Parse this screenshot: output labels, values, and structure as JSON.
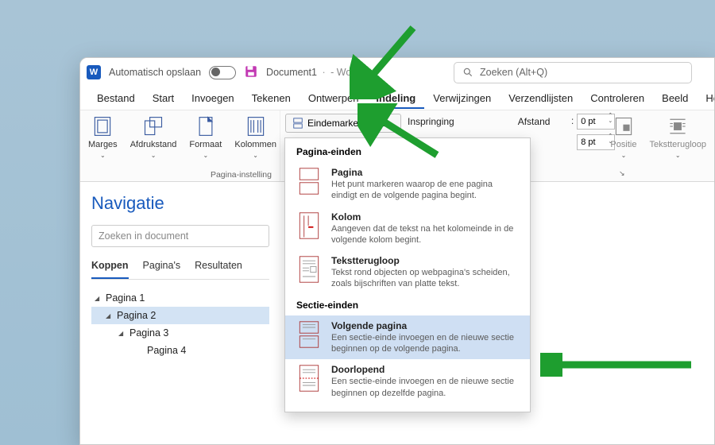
{
  "titlebar": {
    "autosave_label": "Automatisch opslaan",
    "doc_title": "Document1",
    "doc_suffix": "- Word",
    "search_placeholder": "Zoeken (Alt+Q)"
  },
  "menu": [
    "Bestand",
    "Start",
    "Invoegen",
    "Tekenen",
    "Ontwerpen",
    "Indeling",
    "Verwijzingen",
    "Verzendlijsten",
    "Controleren",
    "Beeld",
    "Help"
  ],
  "menu_active_index": 5,
  "ribbon": {
    "page_setup": {
      "margins": "Marges",
      "orientation": "Afdrukstand",
      "size": "Formaat",
      "columns": "Kolommen",
      "group_label": "Pagina-instelling"
    },
    "breaks_label": "Eindemarkeringen",
    "indent_label": "Inspringing",
    "spacing_label": "Afstand",
    "pt_before_label": ":",
    "pt_before_value": "0 pt",
    "pt_after_value": "8 pt",
    "position": "Positie",
    "textwrap": "Tekstterugloop"
  },
  "nav": {
    "title": "Navigatie",
    "search_placeholder": "Zoeken in document",
    "tabs": [
      "Koppen",
      "Pagina's",
      "Resultaten"
    ],
    "tab_active_index": 0,
    "tree": [
      {
        "label": "Pagina 1",
        "indent": 0,
        "caret": true
      },
      {
        "label": "Pagina 2",
        "indent": 1,
        "caret": true,
        "selected": true
      },
      {
        "label": "Pagina 3",
        "indent": 2,
        "caret": true
      },
      {
        "label": "Pagina 4",
        "indent": 3,
        "caret": false
      }
    ]
  },
  "dropdown": {
    "section1": "Pagina-einden",
    "items1": [
      {
        "title": "Pagina",
        "desc": "Het punt markeren waarop de ene pagina eindigt en de volgende pagina begint."
      },
      {
        "title": "Kolom",
        "desc": "Aangeven dat de tekst na het kolomeinde in de volgende kolom begint."
      },
      {
        "title": "Tekstterugloop",
        "desc": "Tekst rond objecten op webpagina's scheiden, zoals bijschriften van platte tekst."
      }
    ],
    "section2": "Sectie-einden",
    "items2": [
      {
        "title": "Volgende pagina",
        "desc": "Een sectie-einde invoegen en de nieuwe sectie beginnen op de volgende pagina.",
        "highlight": true
      },
      {
        "title": "Doorlopend",
        "desc": "Een sectie-einde invoegen en de nieuwe sectie beginnen op dezelfde pagina."
      }
    ]
  }
}
